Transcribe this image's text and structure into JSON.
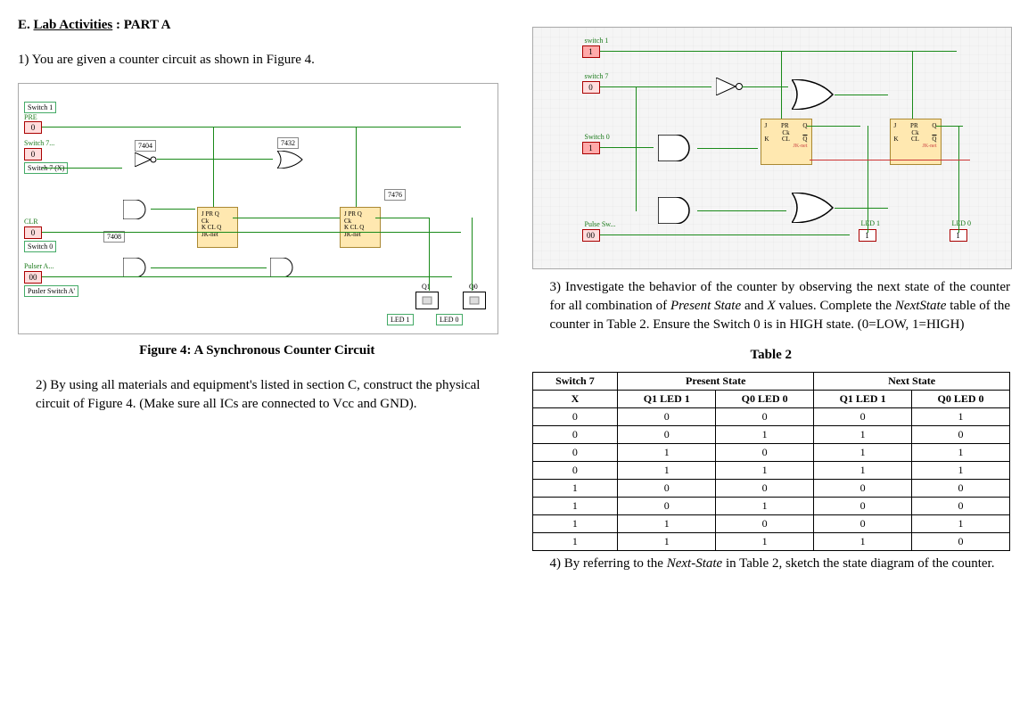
{
  "left": {
    "heading_prefix": "E. ",
    "heading_underline": "Lab Activities",
    "heading_suffix": " : PART A",
    "q1": "1) You are given a counter circuit as shown in Figure 4.",
    "figure_caption": "Figure 4: A Synchronous Counter Circuit",
    "q2": "2) By using all materials and equipment's listed in section C, construct the physical circuit of Figure 4. (Make sure all ICs are connected to Vcc and GND).",
    "diagram": {
      "switch1": "Switch 1",
      "switch7x": "Switch 7 (X)",
      "switch0": "Switch 0",
      "pulser": "Pusler Switch A'",
      "switch7_small": "Switch 7...",
      "pulser_a": "Pulser A...",
      "pre": "PRE",
      "clr": "CLR",
      "ic7404": "7404",
      "ic7432": "7432",
      "ic7408": "7408",
      "ic7476": "7476",
      "jk_text": "J PR Q\nCk\nK CL Q\nJK-net",
      "led1": "LED 1",
      "led0": "LED 0",
      "val0": "0",
      "val00": "00",
      "Q0": "Q0",
      "Q1": "Q1"
    }
  },
  "right": {
    "diagram": {
      "switch1": "switch 1",
      "switch7": "switch 7",
      "switch0": "Switch 0",
      "pulsesw": "Pulse Sw...",
      "led1": "LED 1",
      "led0": "LED 0",
      "jk_j": "J",
      "jk_pr": "PR",
      "jk_q": "Q",
      "jk_ck": "Ck",
      "jk_k": "K",
      "jk_cl": "CL",
      "jk_qbar": "Q",
      "jk_net": "JK-net",
      "v1": "1",
      "v0": "0",
      "v00": "00"
    },
    "q3_a": "3) Investigate the behavior of the counter by observing the next state of the counter for all combination of ",
    "q3_b": "Present State",
    "q3_c": " and ",
    "q3_d": "X",
    "q3_e": " values. Complete the ",
    "q3_f": "NextState",
    "q3_g": " table of the counter in Table 2. Ensure the Switch 0 is in HIGH state. (0=LOW, 1=HIGH)",
    "table_caption": "Table 2",
    "table": {
      "headers": {
        "switch7": "Switch 7",
        "x": "X",
        "present": "Present State",
        "next": "Next State",
        "q1led1": "Q1 LED 1",
        "q0led0": "Q0 LED 0"
      },
      "rows": [
        [
          "0",
          "0",
          "0",
          "0",
          "1"
        ],
        [
          "0",
          "0",
          "1",
          "1",
          "0"
        ],
        [
          "0",
          "1",
          "0",
          "1",
          "1"
        ],
        [
          "0",
          "1",
          "1",
          "1",
          "1"
        ],
        [
          "1",
          "0",
          "0",
          "0",
          "0"
        ],
        [
          "1",
          "0",
          "1",
          "0",
          "0"
        ],
        [
          "1",
          "1",
          "0",
          "0",
          "1"
        ],
        [
          "1",
          "1",
          "1",
          "1",
          "0"
        ]
      ]
    },
    "q4_a": "4) By referring to the ",
    "q4_b": "Next-State",
    "q4_c": " in Table 2, sketch the state diagram of the counter."
  }
}
